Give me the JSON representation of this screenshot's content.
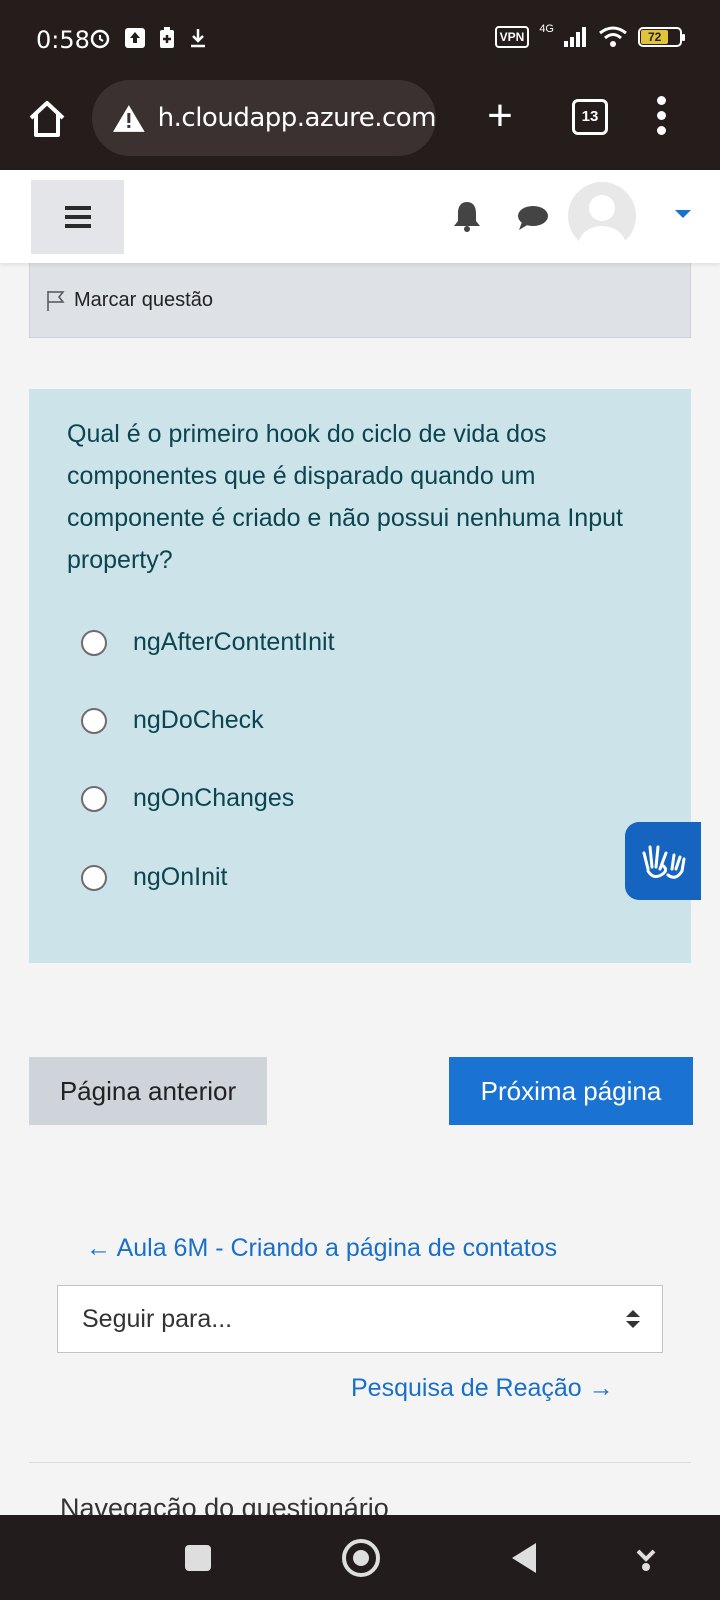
{
  "status_bar": {
    "time": "0:58",
    "vpn": "VPN",
    "network": "4G",
    "battery": "72"
  },
  "browser": {
    "url": "h.cloudapp.azure.com",
    "tab_count": "13"
  },
  "page": {
    "flag_label": "Marcar questão",
    "question_text": "Qual é o primeiro hook do ciclo de vida dos componentes que é disparado quando um componente é criado e não possui nenhuma Input property?",
    "options": [
      "ngAfterContentInit",
      "ngDoCheck",
      "ngOnChanges",
      "ngOnInit"
    ],
    "prev_button": "Página anterior",
    "next_button": "Próxima página",
    "prev_link": "← Aula 6M - Criando a página de contatos",
    "jump_select": "Seguir para...",
    "next_link": "Pesquisa de Reação →",
    "quiz_nav_title": "Navegação do questionário"
  },
  "colors": {
    "question_bg": "#cce3ea",
    "question_text": "#0b4550",
    "primary": "#1a73d2",
    "link": "#1a6fc9"
  },
  "icons": [
    "home-icon",
    "warning-icon",
    "plus-icon",
    "tabs-icon",
    "menu-dots-icon",
    "hamburger-icon",
    "bell-icon",
    "chat-icon",
    "avatar",
    "flag-icon",
    "sign-language-icon"
  ]
}
